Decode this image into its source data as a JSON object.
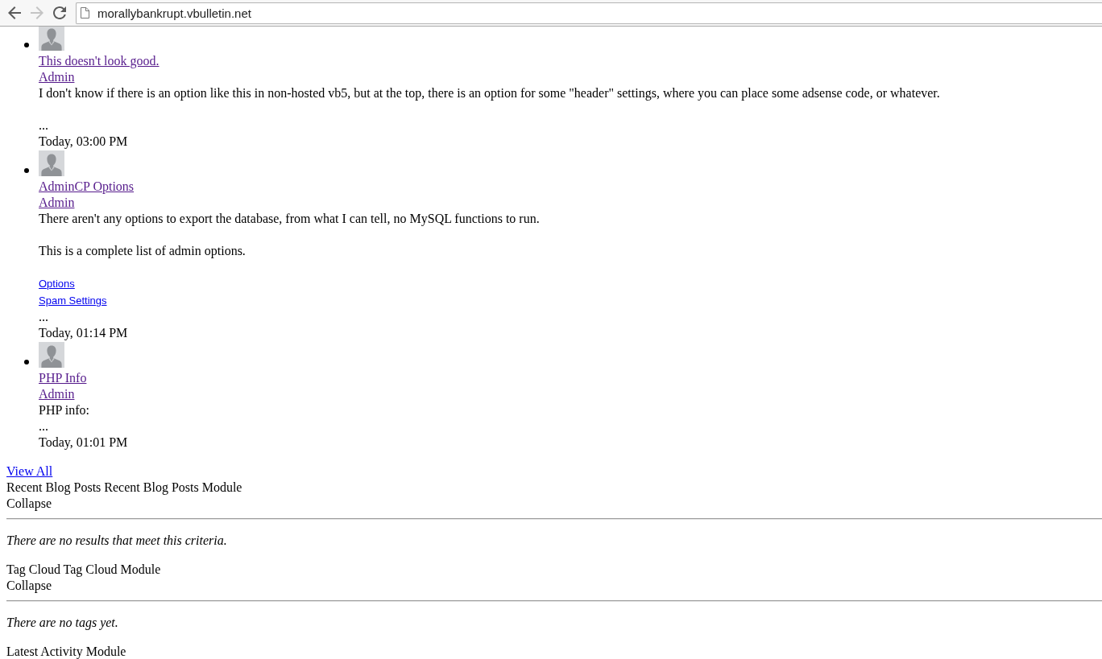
{
  "toolbar": {
    "buttons": [
      {
        "kind": "back",
        "disabled": false
      },
      {
        "kind": "forward",
        "disabled": true
      },
      {
        "kind": "reload",
        "disabled": false
      }
    ],
    "address": "morallybankrupt.vbulletin.net"
  },
  "posts": [
    {
      "title": {
        "text": "This doesn't look good.",
        "visited": true
      },
      "author": {
        "text": "Admin",
        "visited": true
      },
      "paragraphs": [
        {
          "lines": [
            {
              "kind": "text",
              "text": "I don't know if there is an option like this in non-hosted vb5, but at the top, there is an option for some \"header\" settings, where you can place some adsense code, or whatever."
            }
          ]
        },
        {
          "lines": [
            {
              "kind": "ellipsis",
              "text": "..."
            }
          ]
        }
      ],
      "time": "Today, 03:00 PM"
    },
    {
      "title": {
        "text": "AdminCP Options",
        "visited": true
      },
      "author": {
        "text": "Admin",
        "visited": true
      },
      "paragraphs": [
        {
          "lines": [
            {
              "kind": "text",
              "text": "There aren't any options to export the database, from what I can tell, no MySQL functions to run."
            }
          ]
        },
        {
          "lines": [
            {
              "kind": "text",
              "text": "This is a complete list of admin options."
            }
          ]
        },
        {
          "lines": [
            {
              "kind": "link",
              "text": "Options",
              "visited": false
            },
            {
              "kind": "link",
              "text": "Spam Settings",
              "visited": false
            },
            {
              "kind": "ellipsis",
              "text": "..."
            }
          ]
        }
      ],
      "time": "Today, 01:14 PM"
    },
    {
      "title": {
        "text": "PHP Info",
        "visited": true
      },
      "author": {
        "text": "Admin",
        "visited": true
      },
      "paragraphs": [
        {
          "lines": [
            {
              "kind": "text",
              "text": "PHP info:"
            },
            {
              "kind": "ellipsis",
              "text": "..."
            }
          ]
        }
      ],
      "time": "Today, 01:01 PM"
    }
  ],
  "view_all": {
    "text": "View All",
    "visited": false
  },
  "modules": [
    {
      "title": "Recent Blog Posts",
      "label": "Recent Blog Posts Module",
      "collapse": "Collapse",
      "message": "There are no results that meet this criteria."
    },
    {
      "title": "Tag Cloud",
      "label": "Tag Cloud Module",
      "collapse": "Collapse",
      "message": "There are no tags yet."
    },
    {
      "label": "Latest Activity Module"
    }
  ]
}
